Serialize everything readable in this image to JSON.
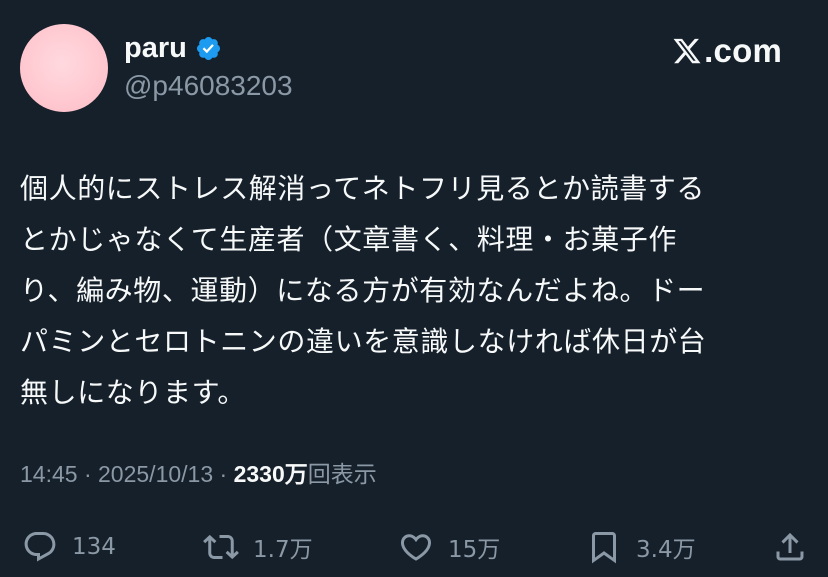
{
  "author": {
    "display_name": "paru",
    "handle": "@p46083203",
    "verified_badge_icon": "verified-badge-icon",
    "avatar_color": "#ffc8d0"
  },
  "brand": {
    "logo_icon": "x-logo-icon",
    "text": ".com"
  },
  "tweet": {
    "lines": [
      "個人的にストレス解消ってネトフリ見るとか読書する",
      "とかじゃなくて生産者（文章書く、料理・お菓子作",
      "り、編み物、運動）になる方が有効なんだよね。ドー",
      "パミンとセロトニンの違いを意識しなければ休日が台",
      "無しになります。"
    ]
  },
  "meta": {
    "time": "14:45",
    "separator": "·",
    "date": "2025/10/13",
    "views_count": "2330万",
    "views_label": "回表示"
  },
  "actions": {
    "reply": {
      "icon": "reply-icon",
      "count": "134"
    },
    "repost": {
      "icon": "repost-icon",
      "count": "1.7万"
    },
    "like": {
      "icon": "heart-icon",
      "count": "15万"
    },
    "bookmark": {
      "icon": "bookmark-icon",
      "count": "3.4万"
    },
    "share": {
      "icon": "share-icon"
    }
  },
  "colors": {
    "background": "#15202b",
    "primary_text": "#f7f9f9",
    "secondary_text": "#8b98a5",
    "verified_blue": "#1d9bf0"
  }
}
